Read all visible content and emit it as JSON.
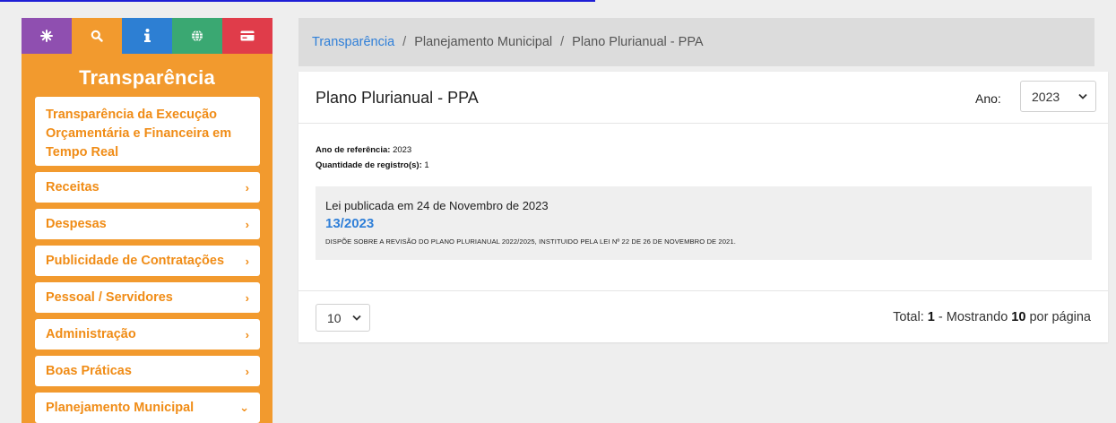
{
  "sidebar": {
    "icons": [
      "gear-icon",
      "search-icon",
      "info-icon",
      "globe-icon",
      "card-icon"
    ],
    "title": "Transparência",
    "items": [
      {
        "label": "Transparência da Execução Orçamentária e Financeira em Tempo Real",
        "chevron": ""
      },
      {
        "label": "Receitas",
        "chevron": "›"
      },
      {
        "label": "Despesas",
        "chevron": "›"
      },
      {
        "label": "Publicidade de Contratações",
        "chevron": "›"
      },
      {
        "label": "Pessoal / Servidores",
        "chevron": "›"
      },
      {
        "label": "Administração",
        "chevron": "›"
      },
      {
        "label": "Boas Práticas",
        "chevron": "›"
      },
      {
        "label": "Planejamento Municipal",
        "chevron": "⌄"
      }
    ]
  },
  "breadcrumb": {
    "items": [
      "Transparência",
      "Planejamento Municipal",
      "Plano Plurianual - PPA"
    ],
    "separator": "/"
  },
  "card": {
    "title": "Plano Plurianual - PPA",
    "year_label": "Ano:",
    "year_value": "2023",
    "meta": {
      "ref_label": "Ano de referência:",
      "ref_value": "2023",
      "count_label": "Quantidade de registro(s):",
      "count_value": "1"
    },
    "record": {
      "published": "Lei publicada em 24 de Novembro de 2023",
      "number": "13/2023",
      "description": "DISPÕE SOBRE A REVISÃO DO PLANO PLURIANUAL 2022/2025, INSTITUIDO PELA LEI Nº 22 DE 26 DE NOVEMBRO DE 2021."
    },
    "footer": {
      "per_page_value": "10",
      "total_prefix": "Total:",
      "total_value": "1",
      "showing_prefix": "- Mostrando",
      "per_page_count": "10",
      "per_page_suffix": "por página"
    }
  },
  "colors": {
    "sidebar": "#f29a2e",
    "link": "#2f7fd8",
    "icon_purple": "#8f4fb0",
    "icon_blue": "#2d7fd3",
    "icon_green": "#3aa872",
    "icon_red": "#e03c4a"
  }
}
